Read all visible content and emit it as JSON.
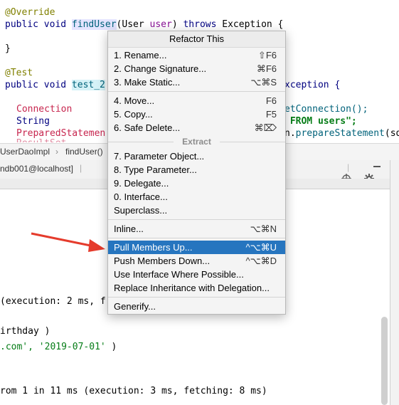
{
  "editor": {
    "lines": [
      {
        "anno": "@Override"
      },
      {
        "kw1": "public void ",
        "fn": "findUser",
        "open": "(",
        "type": "User ",
        "param": "user",
        "close": ") ",
        "kw2": "throws ",
        "ex": "Exception {"
      },
      {
        "text": "}"
      },
      {
        "anno": "@Test"
      },
      {
        "kw1": "public void ",
        "fn": "test_2",
        "tail": "xception {"
      },
      {
        "local": "Connection",
        "tail": "etConnection();"
      },
      {
        "type": "String",
        "tail": " FROM users\";",
        "tail_kw": "\" FROM users\";"
      },
      {
        "local": "PreparedStatemen",
        "meth_prefix": "n.",
        "meth": "prepareStatement",
        "tail": "(sq"
      }
    ]
  },
  "breadcrumb": {
    "items": [
      "UserDaoImpl",
      "findUser()"
    ],
    "separator": "›"
  },
  "toolwindow": {
    "tab": "ndb001@localhost]",
    "right_tab": "P"
  },
  "console": {
    "lines": [
      "(execution: 2 ms, f",
      "irthday )",
      ".com', '2019-07-01' )",
      "rom 1 in 11 ms (execution: 3 ms, fetching: 8 ms)"
    ],
    "values_prefix": ".com', ",
    "values_date": "'2019-07-01'",
    "values_suffix": " )"
  },
  "menu": {
    "title": "Refactor This",
    "items": [
      {
        "label": "1. Rename...",
        "shortcut": "⇧F6"
      },
      {
        "label": "2. Change Signature...",
        "shortcut": "⌘F6"
      },
      {
        "label": "3. Make Static...",
        "shortcut": "⌥⌘S"
      },
      {
        "label": "4. Move...",
        "shortcut": "F6"
      },
      {
        "label": "5. Copy...",
        "shortcut": "F5"
      },
      {
        "label": "6. Safe Delete...",
        "shortcut": "⌘⌦"
      },
      {
        "label": "7. Parameter Object...",
        "shortcut": ""
      },
      {
        "label": "8. Type Parameter...",
        "shortcut": ""
      },
      {
        "label": "9. Delegate...",
        "shortcut": ""
      },
      {
        "label": "0. Interface...",
        "shortcut": ""
      },
      {
        "label": "Superclass...",
        "shortcut": ""
      },
      {
        "label": "Inline...",
        "shortcut": "⌥⌘N"
      },
      {
        "label": "Pull Members Up...",
        "shortcut": "^⌥⌘U"
      },
      {
        "label": "Push Members Down...",
        "shortcut": "^⌥⌘D"
      },
      {
        "label": "Use Interface Where Possible...",
        "shortcut": ""
      },
      {
        "label": "Replace Inheritance with Delegation...",
        "shortcut": ""
      },
      {
        "label": "Generify...",
        "shortcut": ""
      }
    ],
    "extract_header": "Extract",
    "selected_index": 12
  },
  "colors": {
    "selection": "#2675bf",
    "arrow": "#e53b2c",
    "annotation": "#808000",
    "keyword": "#000080",
    "string": "#067d17"
  }
}
